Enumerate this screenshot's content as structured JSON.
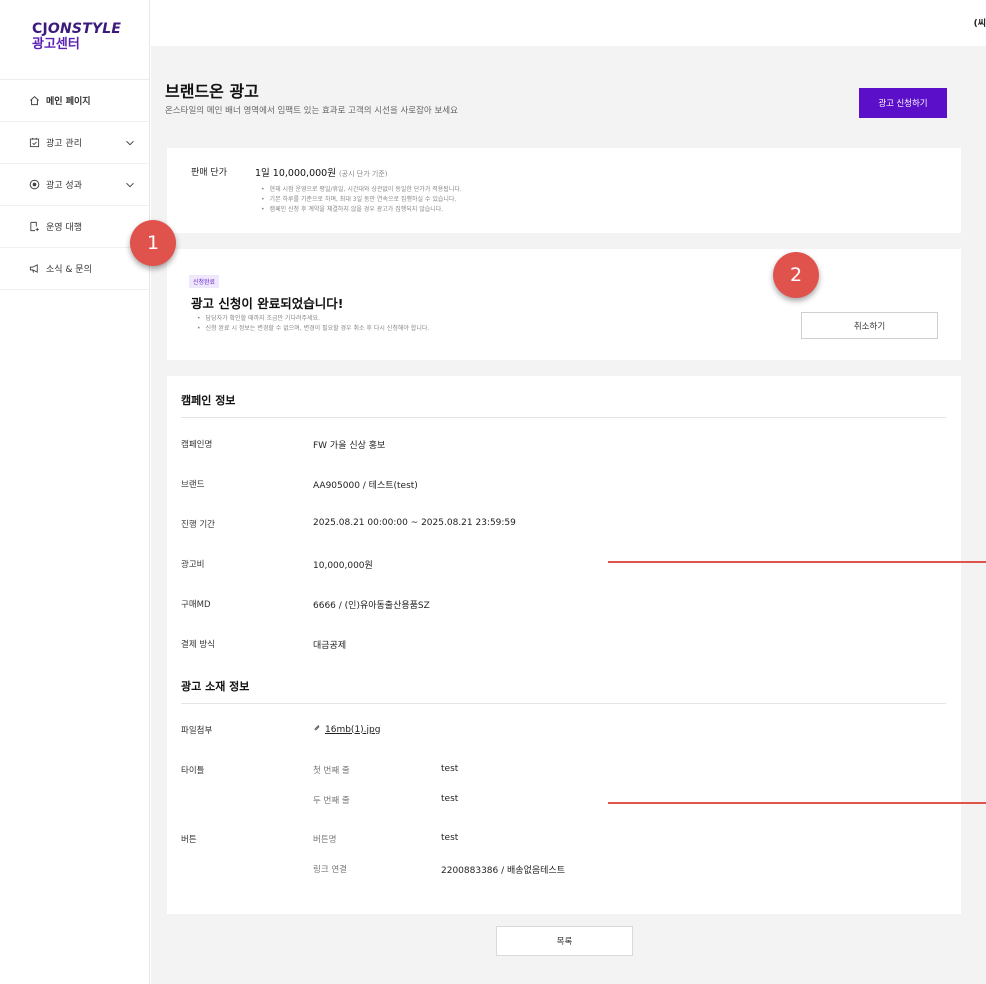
{
  "logo": {
    "brand_cj": "CJ",
    "brand_style": "ONSTYLE",
    "subtitle": "광고센터"
  },
  "sidebar": {
    "items": [
      {
        "label": "메인 페이지",
        "icon": "home-icon"
      },
      {
        "label": "광고 관리",
        "icon": "calendar-check-icon"
      },
      {
        "label": "광고 성과",
        "icon": "chart-circle-icon"
      },
      {
        "label": "운영 대행",
        "icon": "document-plus-icon"
      },
      {
        "label": "소식 & 문의",
        "icon": "megaphone-icon"
      }
    ]
  },
  "topbar": {
    "user": "(씨"
  },
  "page": {
    "title": "브랜드온 광고",
    "description": "온스타일의 메인 배너 영역에서 임팩트 있는 효과로 고객의 시선을 사로잡아 보세요",
    "apply_label": "광고 신청하기"
  },
  "price": {
    "label": "판매 단가",
    "value": "1일 10,000,000원",
    "note": "(공시 단가 기준)",
    "notes": [
      "현재 시점 운영으로 평일/휴일, 시간대와 상관없이 동일한 단가가 적용됩니다.",
      "기본 하루를 기준으로 하며, 최대 3일 동안 연속으로 집행하실 수 있습니다.",
      "캠페인 신청 후 계약을 체결하지 않을 경우 광고가 집행되지 않습니다."
    ]
  },
  "done": {
    "badge": "신청완료",
    "title": "광고 신청이 완료되었습니다!",
    "notes": [
      "담당자가 확인할 때까지 조금만 기다려주세요.",
      "신청 완료 시 정보는 변경할 수 없으며, 변경이 필요할 경우 취소 후 다시 신청해야 합니다."
    ],
    "cancel_label": "취소하기"
  },
  "campaign": {
    "section_title": "캠페인 정보",
    "rows": [
      {
        "label": "캠페인명",
        "value": "FW 가을 신상 홍보"
      },
      {
        "label": "브랜드",
        "value": "AA905000 / 테스트(test)"
      },
      {
        "label": "진행 기간",
        "value": "2025.08.21 00:00:00 ~ 2025.08.21 23:59:59"
      },
      {
        "label": "광고비",
        "value": "10,000,000원"
      },
      {
        "label": "구매MD",
        "value": "6666 / (인)유아동출산용품SZ"
      },
      {
        "label": "결제 방식",
        "value": "대금공제"
      }
    ]
  },
  "creative": {
    "section_title": "광고 소재 정보",
    "file_label": "파일첨부",
    "file_name": "16mb(1).jpg",
    "title_label": "타이틀",
    "title_rows": [
      {
        "label": "첫 번째 줄",
        "value": "test"
      },
      {
        "label": "두 번째 줄",
        "value": "test"
      }
    ],
    "button_label": "버튼",
    "button_rows": [
      {
        "label": "버튼명",
        "value": "test"
      },
      {
        "label": "링크 연결",
        "value": "2200883386 / 배송없음테스트"
      }
    ]
  },
  "list_label": "목록",
  "markers": {
    "one": "1",
    "two": "2"
  },
  "colors": {
    "accent": "#5b0fc8",
    "marker": "#e0534d",
    "background": "#f3f3f4"
  }
}
